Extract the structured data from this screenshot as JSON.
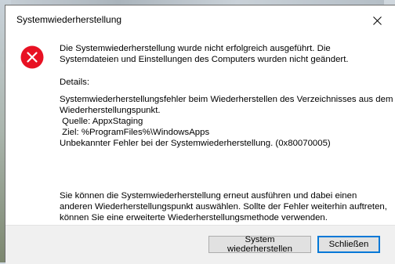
{
  "dialog": {
    "title": "Systemwiederherstellung",
    "message": "Die Systemwiederherstellung wurde nicht erfolgreich ausgeführt. Die Systemdateien und Einstellungen des Computers wurden nicht geändert.",
    "details_title": "Details:",
    "details_lines": [
      "Systemwiederherstellungsfehler beim Wiederherstellen des Verzeichnisses aus dem",
      "Wiederherstellungspunkt.",
      " Quelle: AppxStaging",
      " Ziel: %ProgramFiles%\\WindowsApps",
      "Unbekannter Fehler bei der Systemwiederherstellung. (0x80070005)"
    ],
    "advice": "Sie können die Systemwiederherstellung erneut ausführen und dabei einen anderen Wiederherstellungspunkt auswählen. Sollte der Fehler weiterhin auftreten, können Sie eine erweiterte Wiederherstellungsmethode verwenden.",
    "buttons": {
      "restore_label": "System wiederherstellen",
      "close_label": "Schließen"
    },
    "icons": {
      "error": "error-icon",
      "close": "close-icon"
    },
    "colors": {
      "error_red": "#e81123",
      "focus_blue": "#0078d7"
    }
  }
}
